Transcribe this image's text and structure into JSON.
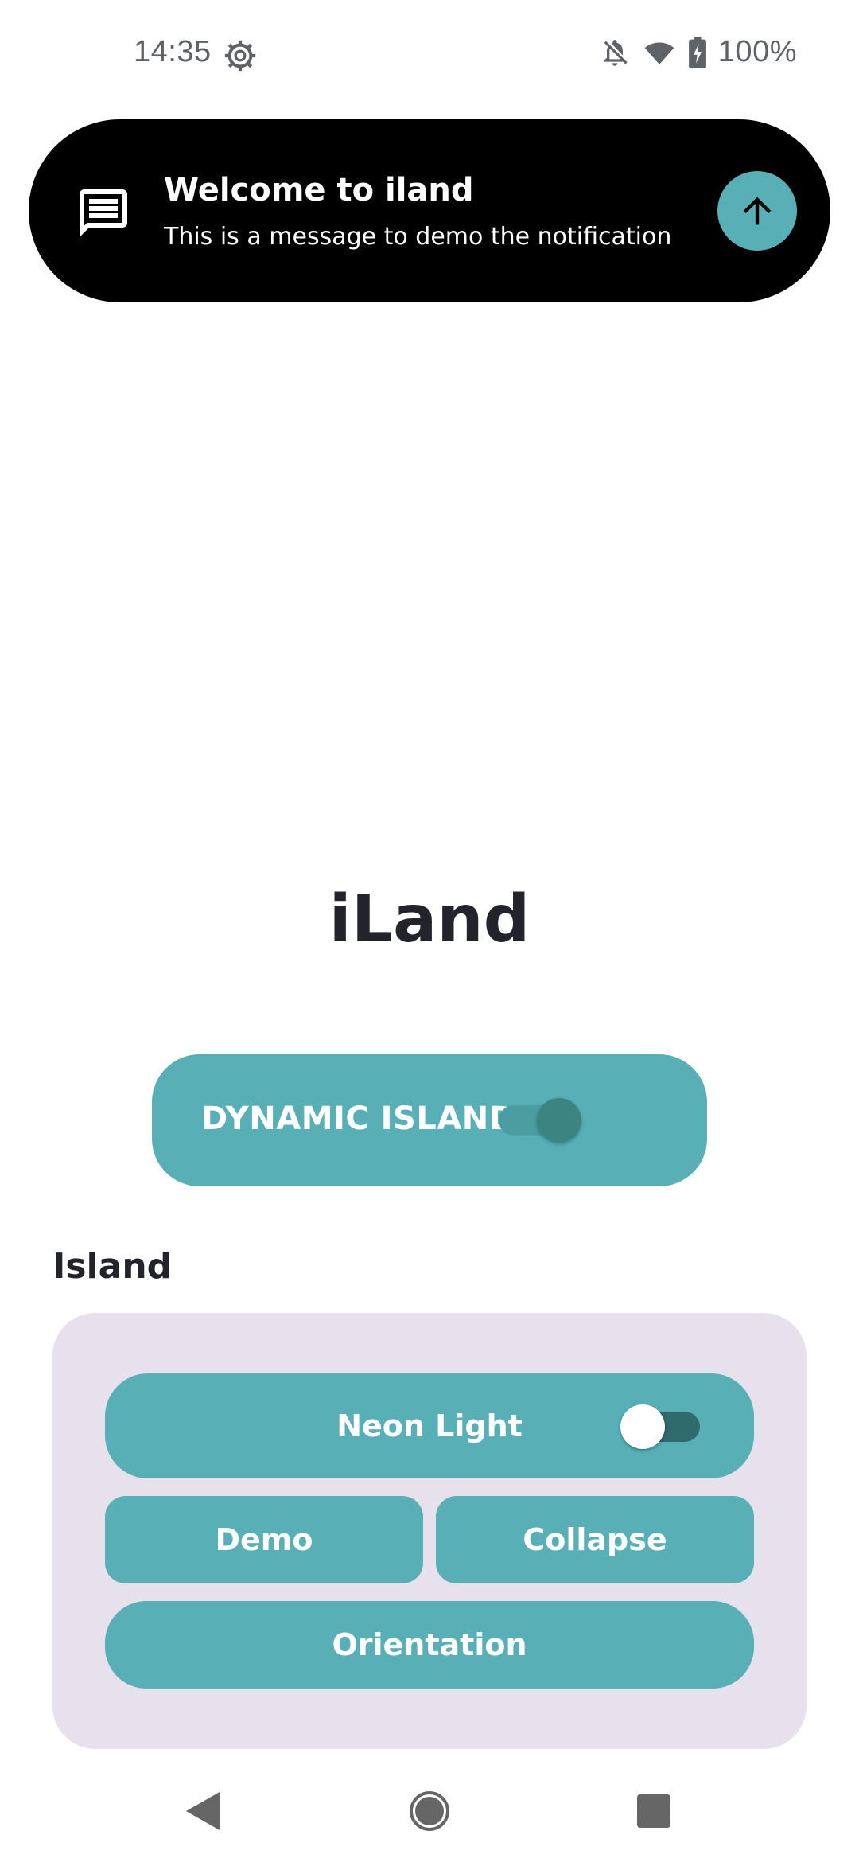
{
  "status_bar": {
    "time": "14:35",
    "battery": "100%",
    "icons": [
      "gear-icon",
      "bell-off-icon",
      "wifi-icon",
      "battery-charging-icon"
    ]
  },
  "notification": {
    "title": "Welcome to iland",
    "message": "This is a message to demo the notification",
    "leading_icon": "message-icon",
    "action_icon": "arrow-up-icon"
  },
  "app": {
    "title": "iLand"
  },
  "dynamic_island": {
    "label": "DYNAMIC ISLAND",
    "toggle_on": true
  },
  "island_section": {
    "heading": "Island",
    "neon_light": {
      "label": "Neon Light",
      "toggle_on": false
    },
    "demo_label": "Demo",
    "collapse_label": "Collapse",
    "orientation_label": "Orientation"
  },
  "nav_bar": {
    "icons": [
      "back-icon",
      "home-icon",
      "recents-icon"
    ]
  },
  "colors": {
    "accent": "#58afb6",
    "card_background": "#e6e1ec",
    "island_background": "#000000",
    "text_dark": "#23232b"
  }
}
